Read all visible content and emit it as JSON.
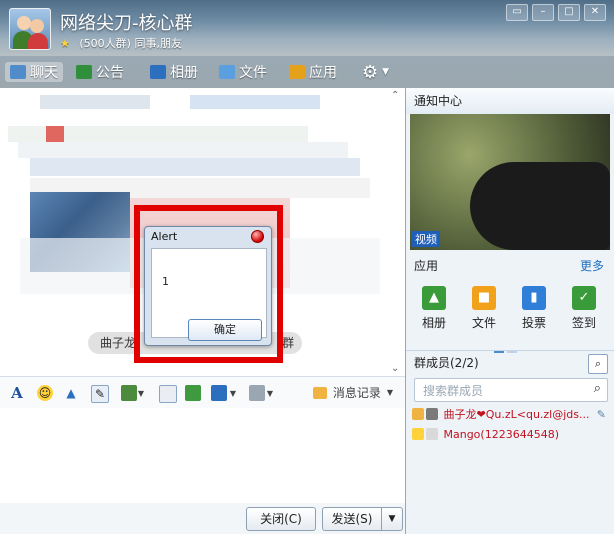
{
  "window": {
    "title": "网络尖刀-核心群",
    "subtitle": "(500人群) 同事,朋友",
    "controls": [
      "restore",
      "minimize",
      "maximize",
      "close"
    ]
  },
  "nav": [
    {
      "label": "聊天",
      "icon": "chat-icon"
    },
    {
      "label": "公告",
      "icon": "announcement-icon"
    },
    {
      "label": "相册",
      "icon": "album-icon"
    },
    {
      "label": "文件",
      "icon": "folder-icon"
    },
    {
      "label": "应用",
      "icon": "apps-icon"
    }
  ],
  "chat": {
    "member_tag_left": "曲子龙",
    "member_tag_right": "群"
  },
  "toolbar": {
    "history_label": "消息记录"
  },
  "bottom": {
    "close_label": "关闭(C)",
    "send_label": "发送(S)"
  },
  "right": {
    "notify_title": "通知中心",
    "video_label": "视频",
    "apps_title": "应用",
    "more_label": "更多",
    "apps": [
      {
        "label": "相册",
        "color": "#3a9b3a",
        "icon": "album-icon"
      },
      {
        "label": "文件",
        "color": "#f2a21a",
        "icon": "folder-icon"
      },
      {
        "label": "投票",
        "color": "#2f7fd8",
        "icon": "vote-icon"
      },
      {
        "label": "签到",
        "color": "#3a9b3a",
        "icon": "checkin-icon"
      }
    ],
    "members_title": "群成员(2/2)",
    "search_placeholder": "搜索群成员",
    "members": [
      {
        "name": "曲子龙❤Qu.zL<qu.zl@jds...",
        "role": "owner"
      },
      {
        "name": "Mango(1223644548)",
        "role": "admin"
      }
    ]
  },
  "alert": {
    "title": "Alert",
    "message": "1",
    "ok_label": "确定"
  },
  "colors": {
    "highlight_frame": "#e00000",
    "member_name": "#c1121f",
    "link": "#1f6fc1"
  }
}
